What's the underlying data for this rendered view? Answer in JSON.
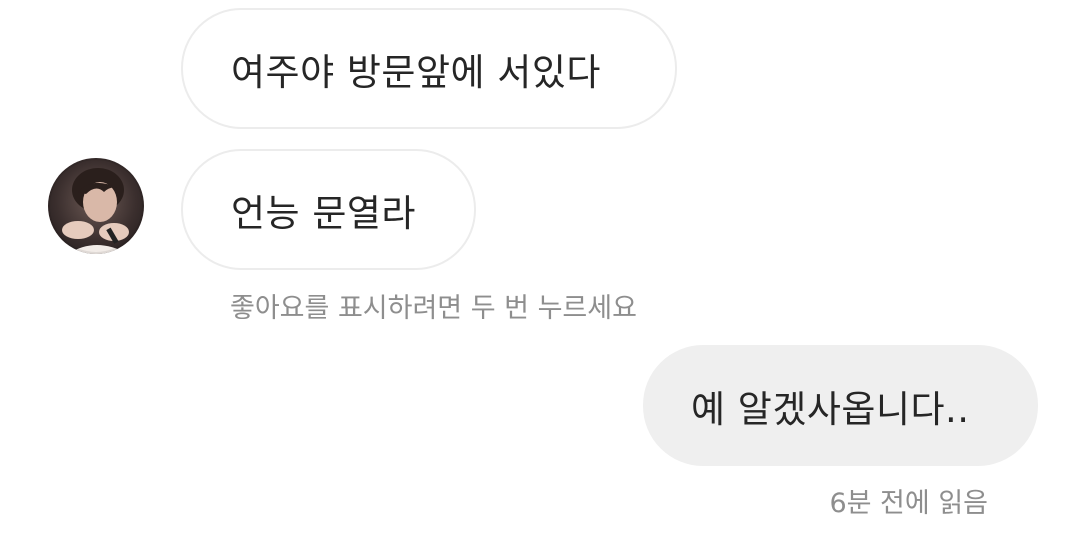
{
  "messages": [
    {
      "direction": "incoming",
      "text": "여주야 방문앞에 서있다"
    },
    {
      "direction": "incoming",
      "text": "언능 문열라"
    },
    {
      "direction": "outgoing",
      "text": "예 알겠사옵니다.."
    }
  ],
  "like_hint": "좋아요를 표시하려면 두 번 누르세요",
  "read_status": "6분 전에 읽음",
  "colors": {
    "incoming_bubble_border": "#ececec",
    "outgoing_bubble_bg": "#efefef",
    "meta_text": "#8e8e8e",
    "message_text": "#262626"
  }
}
